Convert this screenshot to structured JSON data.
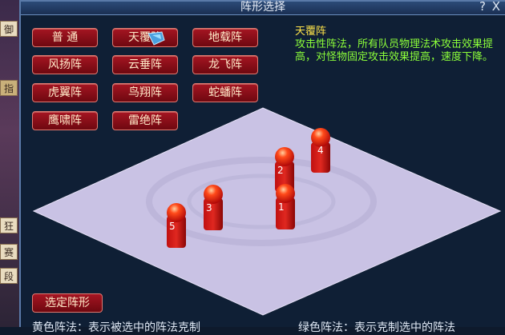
{
  "left_strip": {
    "tabs": [
      "御",
      "指",
      "狂",
      "赛",
      "段"
    ]
  },
  "window": {
    "title": "阵形选择",
    "help_label": "?",
    "close_label": "X"
  },
  "formations": [
    {
      "label": "普 通"
    },
    {
      "label": "天覆阵"
    },
    {
      "label": "地载阵"
    },
    {
      "label": "风扬阵"
    },
    {
      "label": "云垂阵"
    },
    {
      "label": "龙飞阵"
    },
    {
      "label": "虎翼阵"
    },
    {
      "label": "鸟翔阵"
    },
    {
      "label": "蛇蟠阵"
    },
    {
      "label": "鹰啸阵"
    },
    {
      "label": "雷绝阵"
    }
  ],
  "description": {
    "title": "天覆阵",
    "text": "攻击性阵法，所有队员物理法术攻击效果提高，对怪物固定攻击效果提高，速度下降。"
  },
  "board": {
    "positions": [
      "1",
      "2",
      "3",
      "4",
      "5"
    ]
  },
  "actions": {
    "select_label": "选定阵形"
  },
  "legend": {
    "yellow": "黄色阵法：表示被选中的阵法克制",
    "green": "绿色阵法：表示克制选中的阵法"
  }
}
